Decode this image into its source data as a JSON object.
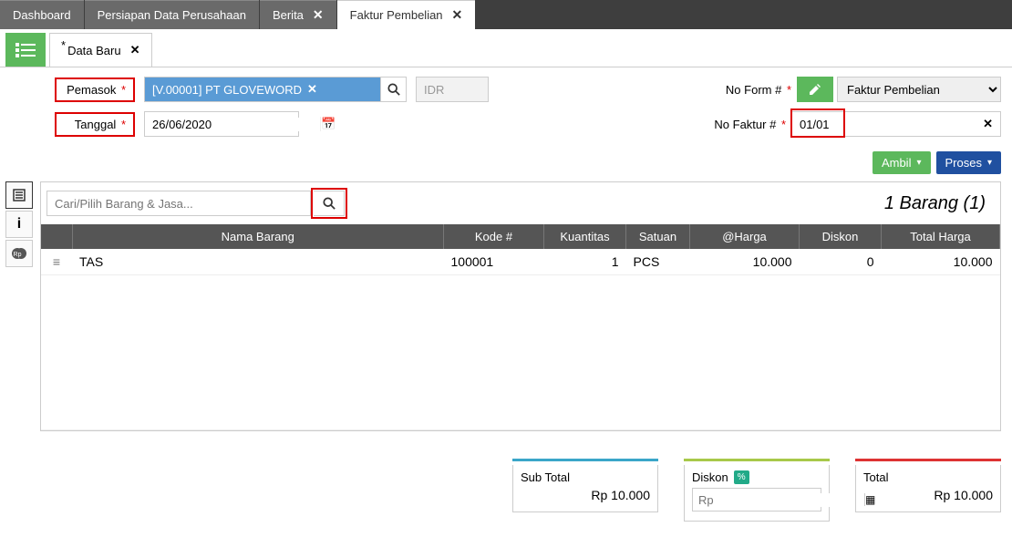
{
  "top_tabs": {
    "dashboard": "Dashboard",
    "persiapan": "Persiapan Data Perusahaan",
    "berita": "Berita",
    "faktur": "Faktur Pembelian"
  },
  "sub_tab": {
    "label": "Data Baru"
  },
  "labels": {
    "pemasok": "Pemasok",
    "tanggal": "Tanggal",
    "no_form": "No Form #",
    "no_faktur": "No Faktur #"
  },
  "supplier": {
    "value": "[V.00001] PT GLOVEWORD"
  },
  "currency": "IDR",
  "form_type_options": [
    "Faktur Pembelian"
  ],
  "form_type_value": "Faktur Pembelian",
  "date": "26/06/2020",
  "no_faktur": "01/01",
  "buttons": {
    "ambil": "Ambil",
    "proses": "Proses"
  },
  "item_search_placeholder": "Cari/Pilih Barang & Jasa...",
  "item_count_label": "1 Barang (1)",
  "table": {
    "headers": {
      "nama": "Nama Barang",
      "kode": "Kode #",
      "kuantitas": "Kuantitas",
      "satuan": "Satuan",
      "harga": "@Harga",
      "diskon": "Diskon",
      "total": "Total Harga"
    },
    "rows": [
      {
        "nama": "TAS",
        "kode": "100001",
        "kuantitas": "1",
        "satuan": "PCS",
        "harga": "10.000",
        "diskon": "0",
        "total": "10.000"
      }
    ]
  },
  "totals": {
    "sub_label": "Sub Total",
    "sub_value": "Rp 10.000",
    "diskon_label": "Diskon",
    "diskon_pct": "%",
    "diskon_placeholder": "Rp",
    "total_label": "Total",
    "total_value": "Rp 10.000"
  }
}
